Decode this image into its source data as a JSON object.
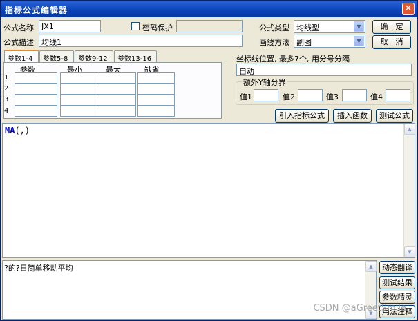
{
  "window": {
    "title": "指标公式编辑器"
  },
  "form": {
    "name_label": "公式名称",
    "name_value": "JX1",
    "password_label": "密码保护",
    "type_label": "公式类型",
    "type_value": "均线型",
    "desc_label": "公式描述",
    "desc_value": "均线1",
    "draw_label": "画线方法",
    "draw_value": "副图"
  },
  "buttons": {
    "ok": "确　定",
    "cancel": "取　消",
    "import_formula": "引入指标公式",
    "insert_function": "插入函数",
    "test_formula": "测试公式"
  },
  "tabs": [
    "参数1-4",
    "参数5-8",
    "参数9-12",
    "参数13-16"
  ],
  "params": {
    "headers": [
      "参数",
      "最小",
      "最大",
      "缺省"
    ],
    "rows": [
      "1",
      "2",
      "3",
      "4"
    ]
  },
  "coord": {
    "label": "坐标线位置, 最多7个, 用分号分隔",
    "value": "自动"
  },
  "extra_y": {
    "group_label": "额外Y轴分界",
    "v1": "值1",
    "v2": "值2",
    "v3": "值3",
    "v4": "值4"
  },
  "editor": {
    "func": "MA",
    "rest": "(,)"
  },
  "output": {
    "text": "?的?日简单移动平均"
  },
  "side_buttons": [
    "动态翻译",
    "测试结果",
    "参数精灵",
    "用法注释"
  ],
  "watermark": "CSDN @aGreetSmile"
}
